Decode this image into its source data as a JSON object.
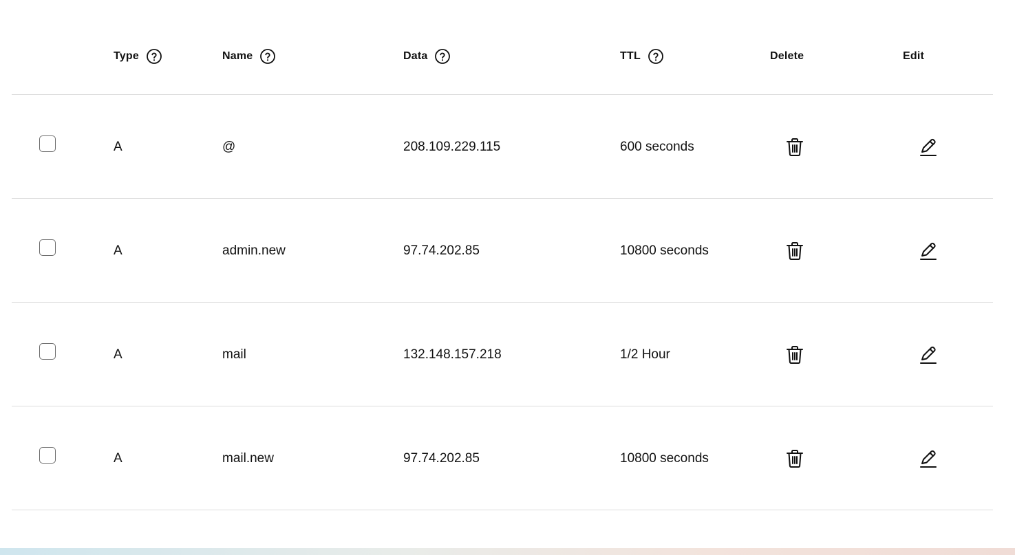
{
  "table": {
    "headers": {
      "type": "Type",
      "name": "Name",
      "data": "Data",
      "ttl": "TTL",
      "delete": "Delete",
      "edit": "Edit"
    },
    "rows": [
      {
        "type": "A",
        "name": "@",
        "data": "208.109.229.115",
        "ttl": "600 seconds"
      },
      {
        "type": "A",
        "name": "admin.new",
        "data": "97.74.202.85",
        "ttl": "10800 seconds"
      },
      {
        "type": "A",
        "name": "mail",
        "data": "132.148.157.218",
        "ttl": "1/2 Hour"
      },
      {
        "type": "A",
        "name": "mail.new",
        "data": "97.74.202.85",
        "ttl": "10800 seconds"
      }
    ]
  },
  "icons": {
    "help": "question-circle-icon",
    "delete": "trash-icon",
    "edit": "pencil-icon"
  }
}
